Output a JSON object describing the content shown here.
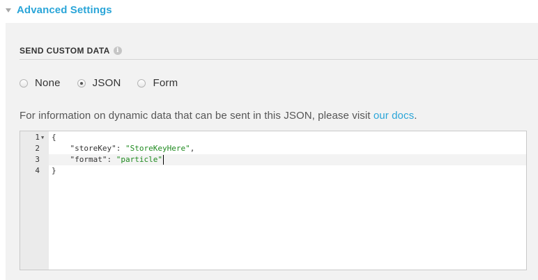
{
  "advanced": {
    "title": "Advanced Settings"
  },
  "custom_data": {
    "title": "SEND CUSTOM DATA",
    "info_icon": "info-icon",
    "options": [
      {
        "label": "None",
        "checked": false
      },
      {
        "label": "JSON",
        "checked": true
      },
      {
        "label": "Form",
        "checked": false
      }
    ],
    "info_text": "For information on dynamic data that can be sent in this JSON, please visit ",
    "info_link": "our docs",
    "info_end": "."
  },
  "editor": {
    "lines": [
      {
        "num": "1",
        "text": "{"
      },
      {
        "num": "2",
        "indent": "    ",
        "key": "\"storeKey\"",
        "sep": ": ",
        "value": "\"StoreKeyHere\"",
        "trail": ","
      },
      {
        "num": "3",
        "indent": "    ",
        "key": "\"format\"",
        "sep": ": ",
        "value": "\"particle\"",
        "trail": ""
      },
      {
        "num": "4",
        "text": "}"
      }
    ]
  },
  "colors": {
    "accent": "#2aa5d8",
    "panel": "#f2f2f2",
    "string": "#1f8a1f"
  }
}
